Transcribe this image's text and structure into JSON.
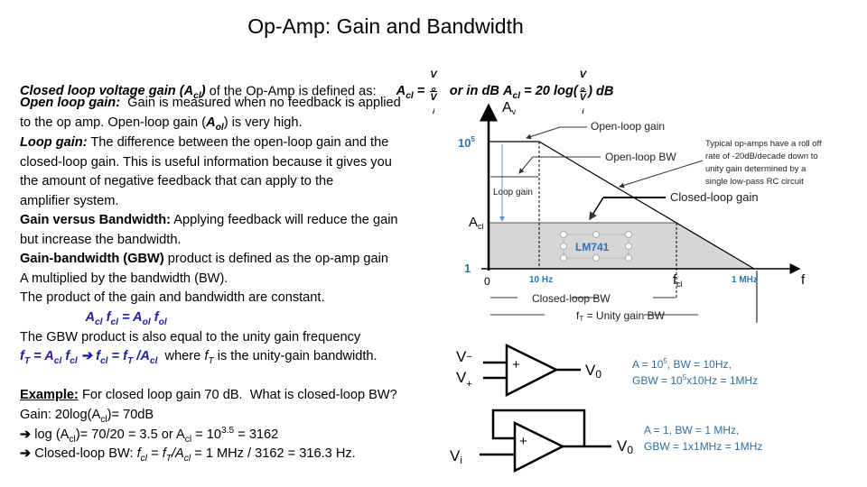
{
  "title": "Op-Amp: Gain and Bandwidth",
  "definition": {
    "lead": "Closed loop voltage gain (A",
    "lead_sub": "cl",
    "lead_end": ")",
    "rest": " of the Op-Amp is defined as:",
    "acl": "A",
    "acl_sub": "cl",
    "eq": " = ",
    "num": "V",
    "num_sub": "o",
    "den": "V",
    "den_sub": "i",
    "or_db": "or in dB",
    "acl2": "A",
    "acl2_sub": "cl",
    "eq2": " = 20 log(",
    "close": ") dB"
  },
  "lines": [
    [
      {
        "t": "Open loop gain:",
        "s": "bi"
      },
      {
        "t": "  Gain is measured when no feedback is applied"
      }
    ],
    [
      {
        "t": "to the op amp. Open-loop gain ("
      },
      {
        "t": "A",
        "s": "bi"
      },
      {
        "t": "ol",
        "s": "sub-bi"
      },
      {
        "t": ") is very high."
      }
    ],
    [
      {
        "t": "Loop gain:",
        "s": "bi"
      },
      {
        "t": " The difference between the open-loop gain and the"
      }
    ],
    [
      {
        "t": "closed-loop gain. This is useful information because it gives you"
      }
    ],
    [
      {
        "t": "the amount of negative feedback that can apply to the"
      }
    ],
    [
      {
        "t": "amplifier system."
      }
    ],
    [
      {
        "t": "Gain versus Bandwidth:",
        "s": "b"
      },
      {
        "t": " Applying feedback will reduce the gain"
      }
    ],
    [
      {
        "t": "but increase the bandwidth."
      }
    ],
    [
      {
        "t": "Gain-bandwidth (GBW)",
        "s": "b"
      },
      {
        "t": " product is defined as the op-amp gain"
      }
    ],
    [
      {
        "t": "A multiplied by the bandwidth (BW)."
      }
    ],
    [
      {
        "t": "The product of the gain and bandwidth are constant."
      }
    ],
    [
      {
        "t": "                  A",
        "s": "blue"
      },
      {
        "t": "cl",
        "s": "sub-blue"
      },
      {
        "t": " f",
        "s": "blue"
      },
      {
        "t": "cl",
        "s": "sub-blue"
      },
      {
        "t": " = A",
        "s": "blue"
      },
      {
        "t": "ol",
        "s": "sub-blue"
      },
      {
        "t": " f",
        "s": "blue"
      },
      {
        "t": "ol",
        "s": "sub-blue"
      }
    ],
    [
      {
        "t": "The GBW product is also equal to the unity gain frequency"
      }
    ],
    [
      {
        "t": "f",
        "s": "blue"
      },
      {
        "t": "T",
        "s": "sub-blue"
      },
      {
        "t": " = A",
        "s": "blue"
      },
      {
        "t": "cl",
        "s": "sub-blue"
      },
      {
        "t": " f",
        "s": "blue"
      },
      {
        "t": "cl",
        "s": "sub-blue"
      },
      {
        "t": " ➔ f",
        "s": "blue"
      },
      {
        "t": "cl",
        "s": "sub-blue"
      },
      {
        "t": " = f",
        "s": "blue"
      },
      {
        "t": "T",
        "s": "sub-blue"
      },
      {
        "t": " /A",
        "s": "blue"
      },
      {
        "t": "cl",
        "s": "sub-blue"
      },
      {
        "t": "  where "
      },
      {
        "t": "f",
        "s": "i"
      },
      {
        "t": "T",
        "s": "sub-i"
      },
      {
        "t": " is the unity-gain bandwidth."
      }
    ],
    [
      {
        "t": "Example:",
        "s": "u"
      },
      {
        "t": " For closed loop gain 70 dB.  What is closed-loop BW?"
      }
    ],
    [
      {
        "t": "Gain: 20log(A"
      },
      {
        "t": "cl",
        "s": "sub"
      },
      {
        "t": ")= 70dB"
      }
    ],
    [
      {
        "t": "➔ ",
        "s": "b"
      },
      {
        "t": "log (A"
      },
      {
        "t": "cl",
        "s": "sub"
      },
      {
        "t": ")= 70/20 = 3.5 or A"
      },
      {
        "t": "cl",
        "s": "sub"
      },
      {
        "t": " = 10"
      },
      {
        "t": "3.5",
        "s": "sup"
      },
      {
        "t": " = 3162"
      }
    ],
    [
      {
        "t": "➔ ",
        "s": "b"
      },
      {
        "t": "Closed-loop BW: "
      },
      {
        "t": "f",
        "s": "i"
      },
      {
        "t": "cl",
        "s": "sub-i"
      },
      {
        "t": " = "
      },
      {
        "t": "f",
        "s": "i"
      },
      {
        "t": "T",
        "s": "sub-i"
      },
      {
        "t": "/A",
        "s": "i"
      },
      {
        "t": "cl",
        "s": "sub-i"
      },
      {
        "t": " = 1 MHz / 3162 = 316.3 Hz."
      }
    ]
  ],
  "graph": {
    "y_axis": "A",
    "y_axis_sub": "v",
    "y_max_label": "10",
    "y_max_sup": "5",
    "acl_label": "A",
    "acl_sub": "cl",
    "one_label": "1",
    "zero_label": "0",
    "f10": "10 Hz",
    "fcl": "f",
    "fcl_sub": "cl",
    "f1m": "1 MHz",
    "x_axis": "f",
    "open_loop_gain": "Open-loop gain",
    "open_loop_bw": "Open-loop BW",
    "loop_gain": "Loop gain",
    "closed_loop_gain": "Closed-loop gain",
    "note": [
      "Typical op-amps have a roll off",
      "rate of -20dB/decade down to",
      "unity gain determined by a",
      "single low-pass RC circuit"
    ],
    "chip": "LM741",
    "closed_loop_bw": "Closed-loop BW",
    "unity_bw": "f",
    "unity_bw_sub": "T",
    "unity_bw_rest": " = Unity gain BW",
    "accent": "#2e75b6"
  },
  "circuits": {
    "open": {
      "vminus": "V",
      "vminus_sub": "−",
      "vplus": "V",
      "vplus_sub": "+",
      "plus": "+",
      "out": "V",
      "out_sub": "0",
      "l1": "A = 10",
      "l1_sup": "5",
      "l1_end": ", BW = 10Hz,",
      "l2": "GBW = 10",
      "l2_sup": "5",
      "l2_end": "x10Hz = 1MHz"
    },
    "follower": {
      "vin": "V",
      "vin_sub": "i",
      "plus": "+",
      "out": "V",
      "out_sub": "0",
      "l1": "A = 1, BW = 1 MHz,",
      "l2": "GBW = 1x1MHz = 1MHz"
    },
    "text_color": "#2f6e9e"
  }
}
